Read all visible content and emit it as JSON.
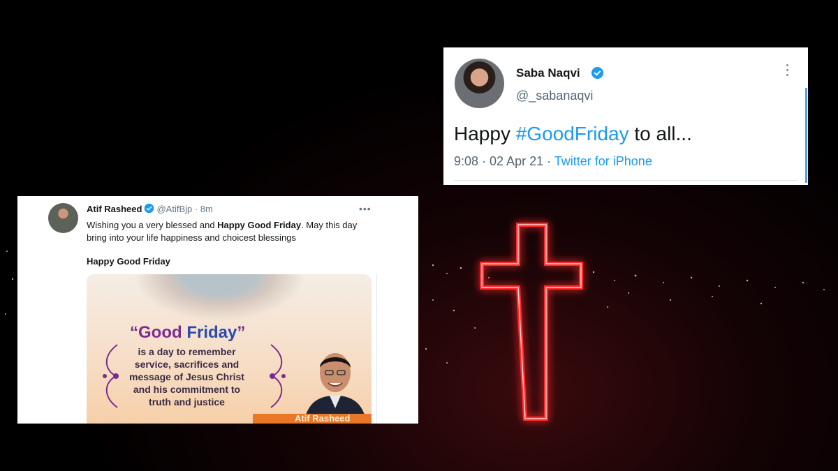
{
  "background": {
    "description_colors": {
      "cross_glow": "#ff2a2a",
      "city_lights": "#ffd9a0",
      "sky": "#000000"
    }
  },
  "tweet_saba": {
    "name": "Saba Naqvi",
    "handle": "@_sabanaqvi",
    "text_prefix": "Happy ",
    "hashtag": "#GoodFriday",
    "text_suffix": " to all...",
    "time_date": "9:08 · 02 Apr 21 · ",
    "source": "Twitter for iPhone",
    "icons": [
      "verified-badge-icon",
      "more-options-icon"
    ]
  },
  "tweet_atif": {
    "name": "Atif Rasheed",
    "handle": "@AtifBjp",
    "time": "· 8m",
    "menu": "•••",
    "body_1": "Wishing you a very blessed and ",
    "body_bold": "Happy Good Friday",
    "body_2": ". May this day bring into your life happiness and choicest blessings",
    "subtitle": "Happy Good Friday",
    "poster": {
      "quote_open": "“",
      "title_good": "Good ",
      "title_friday": "Friday",
      "quote_close": "”",
      "message": "is a day to remember service, sacrifices and message of Jesus Christ and his commitment to truth and justice",
      "banner_name": "Atif Rasheed"
    },
    "colors": {
      "title_purple": "#7b2c8f",
      "title_blue": "#2b4bb0",
      "banner_orange": "#e9772a"
    }
  }
}
